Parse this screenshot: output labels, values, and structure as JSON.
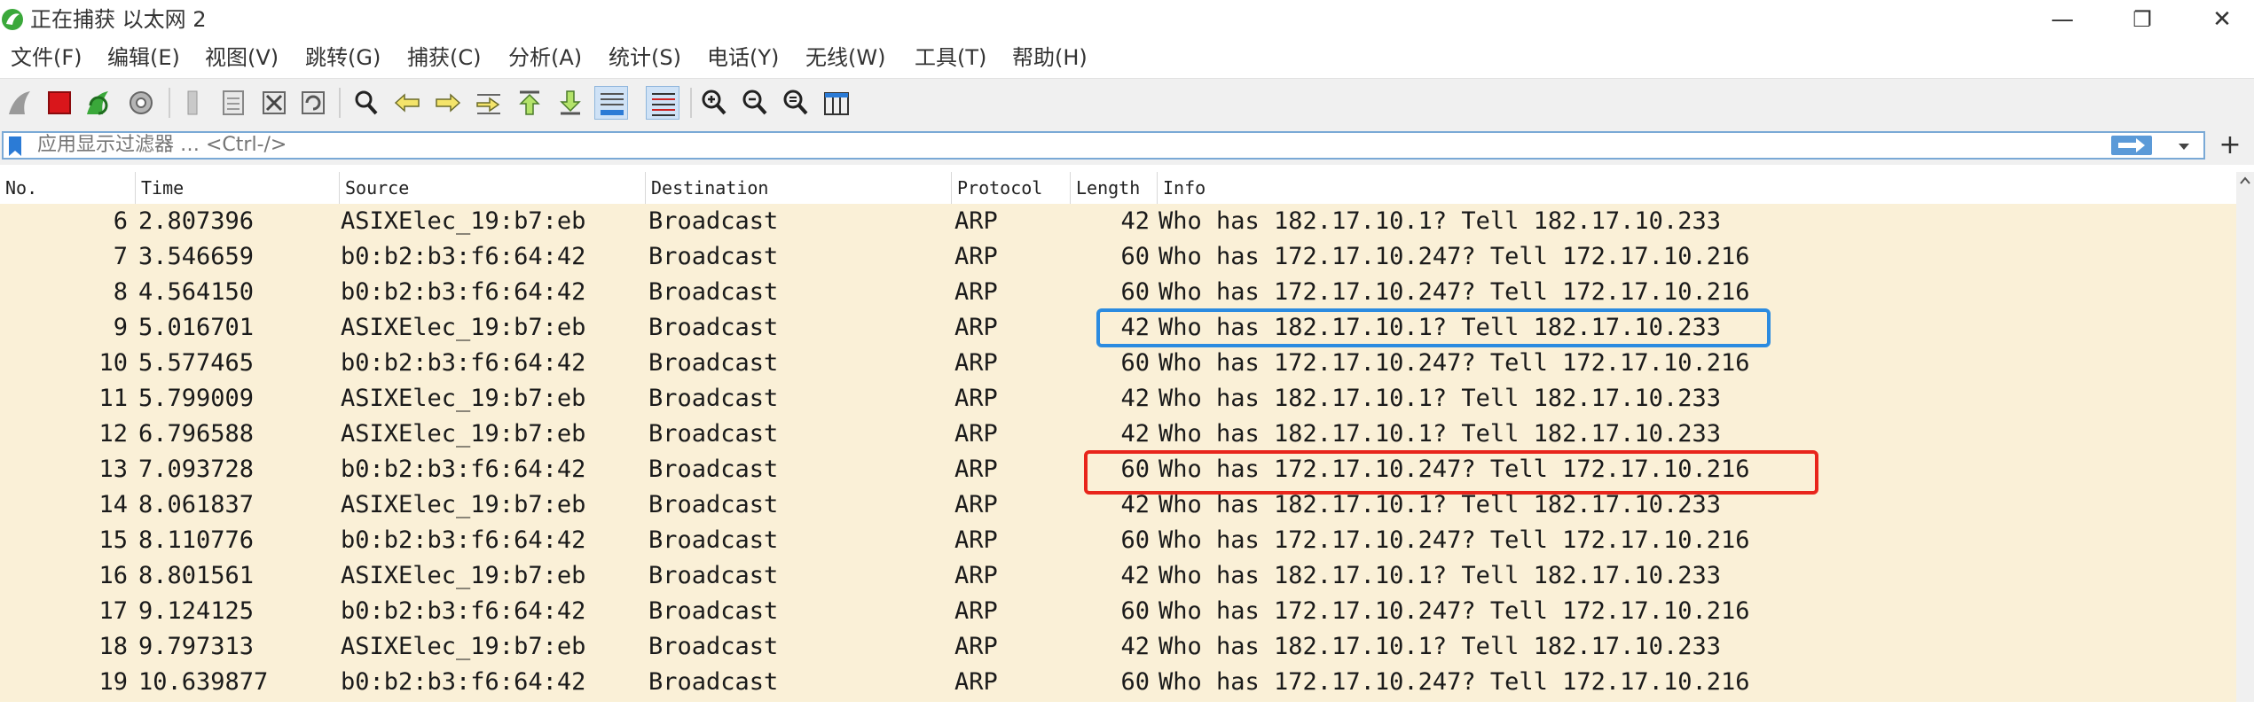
{
  "window": {
    "title": "正在捕获 以太网 2",
    "minimize_glyph": "—",
    "restore_glyph": "❐",
    "close_glyph": "✕"
  },
  "menu": [
    "文件(F)",
    "编辑(E)",
    "视图(V)",
    "跳转(G)",
    "捕获(C)",
    "分析(A)",
    "统计(S)",
    "电话(Y)",
    "无线(W)",
    "工具(T)",
    "帮助(H)"
  ],
  "toolbar": {
    "icons": [
      "shark-fin-start-icon",
      "stop-capture-icon",
      "restart-capture-icon",
      "capture-options-icon",
      "open-file-icon",
      "save-file-icon",
      "close-file-icon",
      "reload-file-icon",
      "find-packet-icon",
      "go-back-icon",
      "go-forward-icon",
      "go-to-packet-icon",
      "first-packet-icon",
      "last-packet-icon",
      "autoscroll-icon",
      "colorize-icon",
      "zoom-in-icon",
      "zoom-out-icon",
      "normal-size-icon",
      "resize-columns-icon"
    ]
  },
  "filter": {
    "placeholder": "应用显示过滤器 … <Ctrl-/>",
    "value": "",
    "plus_label": "+"
  },
  "columns": [
    "No.",
    "Time",
    "Source",
    "Destination",
    "Protocol",
    "Length",
    "Info"
  ],
  "packets": [
    {
      "no": "6",
      "time": "2.807396",
      "source": "ASIXElec_19:b7:eb",
      "destination": "Broadcast",
      "protocol": "ARP",
      "length": "42",
      "info": "Who has 182.17.10.1? Tell 182.17.10.233"
    },
    {
      "no": "7",
      "time": "3.546659",
      "source": "b0:b2:b3:f6:64:42",
      "destination": "Broadcast",
      "protocol": "ARP",
      "length": "60",
      "info": "Who has 172.17.10.247? Tell 172.17.10.216"
    },
    {
      "no": "8",
      "time": "4.564150",
      "source": "b0:b2:b3:f6:64:42",
      "destination": "Broadcast",
      "protocol": "ARP",
      "length": "60",
      "info": "Who has 172.17.10.247? Tell 172.17.10.216"
    },
    {
      "no": "9",
      "time": "5.016701",
      "source": "ASIXElec_19:b7:eb",
      "destination": "Broadcast",
      "protocol": "ARP",
      "length": "42",
      "info": "Who has 182.17.10.1? Tell 182.17.10.233"
    },
    {
      "no": "10",
      "time": "5.577465",
      "source": "b0:b2:b3:f6:64:42",
      "destination": "Broadcast",
      "protocol": "ARP",
      "length": "60",
      "info": "Who has 172.17.10.247? Tell 172.17.10.216"
    },
    {
      "no": "11",
      "time": "5.799009",
      "source": "ASIXElec_19:b7:eb",
      "destination": "Broadcast",
      "protocol": "ARP",
      "length": "42",
      "info": "Who has 182.17.10.1? Tell 182.17.10.233"
    },
    {
      "no": "12",
      "time": "6.796588",
      "source": "ASIXElec_19:b7:eb",
      "destination": "Broadcast",
      "protocol": "ARP",
      "length": "42",
      "info": "Who has 182.17.10.1? Tell 182.17.10.233"
    },
    {
      "no": "13",
      "time": "7.093728",
      "source": "b0:b2:b3:f6:64:42",
      "destination": "Broadcast",
      "protocol": "ARP",
      "length": "60",
      "info": "Who has 172.17.10.247? Tell 172.17.10.216"
    },
    {
      "no": "14",
      "time": "8.061837",
      "source": "ASIXElec_19:b7:eb",
      "destination": "Broadcast",
      "protocol": "ARP",
      "length": "42",
      "info": "Who has 182.17.10.1? Tell 182.17.10.233"
    },
    {
      "no": "15",
      "time": "8.110776",
      "source": "b0:b2:b3:f6:64:42",
      "destination": "Broadcast",
      "protocol": "ARP",
      "length": "60",
      "info": "Who has 172.17.10.247? Tell 172.17.10.216"
    },
    {
      "no": "16",
      "time": "8.801561",
      "source": "ASIXElec_19:b7:eb",
      "destination": "Broadcast",
      "protocol": "ARP",
      "length": "42",
      "info": "Who has 182.17.10.1? Tell 182.17.10.233"
    },
    {
      "no": "17",
      "time": "9.124125",
      "source": "b0:b2:b3:f6:64:42",
      "destination": "Broadcast",
      "protocol": "ARP",
      "length": "60",
      "info": "Who has 172.17.10.247? Tell 172.17.10.216"
    },
    {
      "no": "18",
      "time": "9.797313",
      "source": "ASIXElec_19:b7:eb",
      "destination": "Broadcast",
      "protocol": "ARP",
      "length": "42",
      "info": "Who has 182.17.10.1? Tell 182.17.10.233"
    },
    {
      "no": "19",
      "time": "10.639877",
      "source": "b0:b2:b3:f6:64:42",
      "destination": "Broadcast",
      "protocol": "ARP",
      "length": "60",
      "info": "Who has 172.17.10.247? Tell 172.17.10.216"
    }
  ],
  "highlights": [
    {
      "packet_no": "9",
      "color": "#2b8be0"
    },
    {
      "packet_no": "13",
      "color": "#e8251b"
    }
  ],
  "colors": {
    "row_background": "#faf0d7",
    "filter_border": "#7aa9d6",
    "stop_red": "#d9161b",
    "fin_green": "#3aa83a"
  }
}
